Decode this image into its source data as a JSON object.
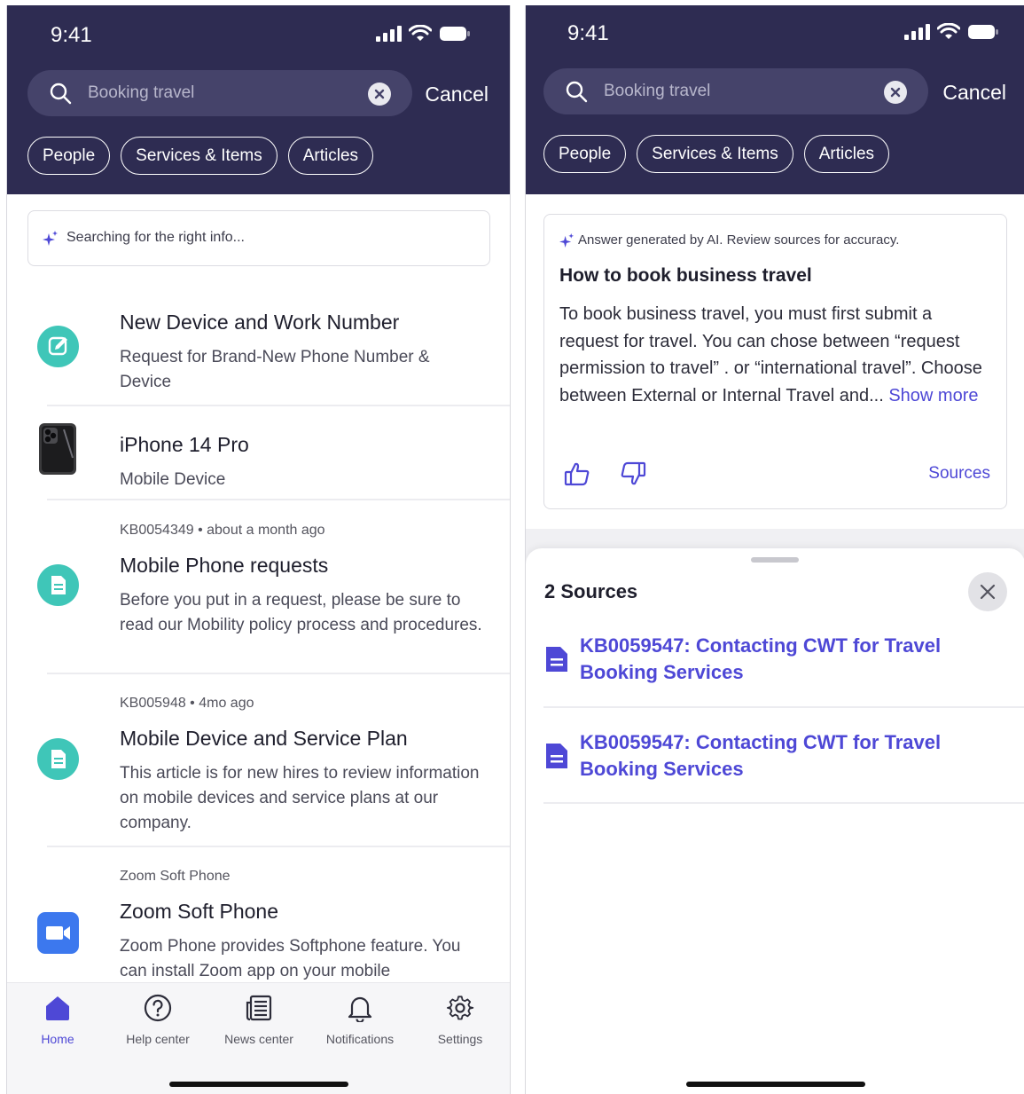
{
  "status": {
    "time": "9:41"
  },
  "search": {
    "query": "Booking travel",
    "cancel_label": "Cancel"
  },
  "chips": [
    "People",
    "Services & Items",
    "Articles"
  ],
  "left": {
    "ai_status": "Searching for the right info...",
    "results": [
      {
        "title": "New Device and Work Number",
        "desc": "Request for Brand-New Phone Number & Device",
        "icon": "edit-icon"
      },
      {
        "title": "iPhone 14 Pro",
        "desc": "Mobile Device",
        "icon": "iphone-thumbnail"
      },
      {
        "meta": "KB0054349 • about a month ago",
        "title": "Mobile Phone requests",
        "desc": "Before you put in a request, please be sure to read our Mobility policy process and procedures.",
        "icon": "article-icon"
      },
      {
        "meta": "KB005948 • 4mo ago",
        "title": "Mobile Device and Service Plan",
        "desc": "This article is for new hires to review information on mobile devices and service plans at our company.",
        "icon": "article-icon"
      },
      {
        "meta": "Zoom Soft Phone",
        "title": "Zoom Soft Phone",
        "desc": "Zoom Phone provides Softphone feature. You can install Zoom app on your mobile",
        "icon": "zoom-icon"
      }
    ],
    "tabs": [
      {
        "label": "Home",
        "icon": "home-icon",
        "active": true
      },
      {
        "label": "Help center",
        "icon": "help-icon"
      },
      {
        "label": "News center",
        "icon": "news-icon"
      },
      {
        "label": "Notifications",
        "icon": "bell-icon"
      },
      {
        "label": "Settings",
        "icon": "gear-icon"
      }
    ]
  },
  "right": {
    "answer": {
      "disclaimer": "Answer generated by AI. Review sources for accuracy.",
      "title": "How to book business travel",
      "body": "To book business travel, you must first submit a request for travel. You can chose between “request permission to travel” .   or “international travel”. Choose between External or Internal Travel and...",
      "show_more": "Show more",
      "sources_link": "Sources"
    },
    "sheet": {
      "title": "2 Sources",
      "items": [
        "KB0059547: Contacting CWT for Travel Booking Services",
        "KB0059547: Contacting CWT for Travel Booking Services"
      ]
    }
  },
  "colors": {
    "header": "#2e2c52",
    "accent": "#4e48d6",
    "teal": "#3fc6b8",
    "zoom": "#3c78ee"
  }
}
